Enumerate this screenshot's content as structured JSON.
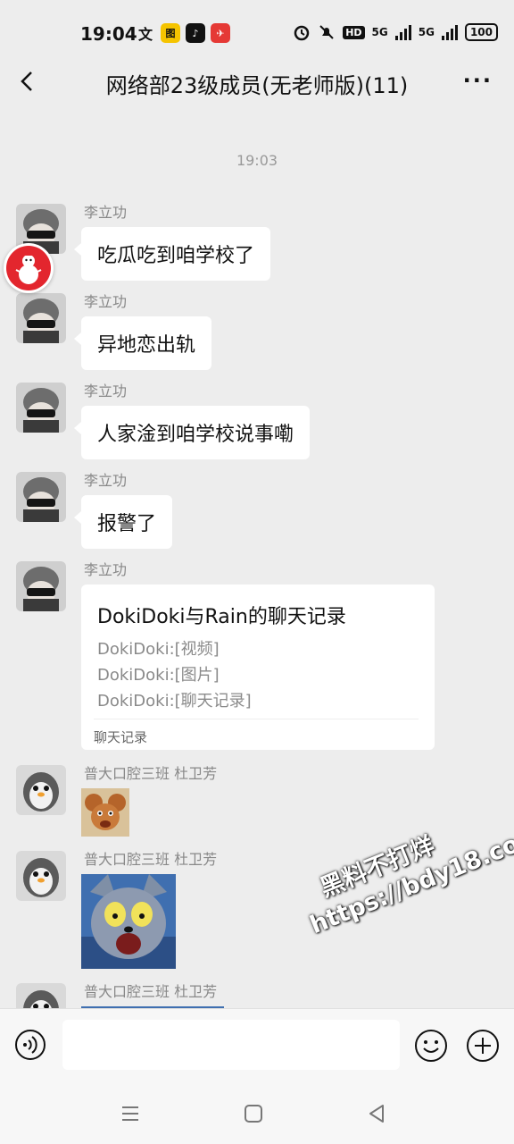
{
  "status": {
    "time": "19:04",
    "app_badges": [
      {
        "name": "translate",
        "label": "文",
        "color": "#ffffff",
        "text_color": "#111111"
      },
      {
        "name": "app-yellow",
        "label": "图",
        "color": "#f5c400",
        "text_color": "#111111"
      },
      {
        "name": "tiktok",
        "label": "♪",
        "color": "#111111",
        "text_color": "#ffffff"
      },
      {
        "name": "app-red",
        "label": "✈",
        "color": "#e53935",
        "text_color": "#ffffff"
      }
    ],
    "hd_label": "HD",
    "network_1": "5G",
    "network_2": "5G",
    "battery": "100"
  },
  "header": {
    "title": "网络部23级成员(无老师版)(11)",
    "back_icon": "chevron-left-icon",
    "more_icon": "more-dots-icon",
    "more_label": "···"
  },
  "timestamp": "19:03",
  "messages": [
    {
      "sender": "李立功",
      "text": "吃瓜吃到咱学校了"
    },
    {
      "sender": "李立功",
      "text": "异地恋出轨"
    },
    {
      "sender": "李立功",
      "text": "人家淦到咱学校说事嘞"
    },
    {
      "sender": "李立功",
      "text": "报警了"
    },
    {
      "sender": "李立功",
      "card": {
        "title": "DokiDoki与Rain的聊天记录",
        "lines": [
          "DokiDoki:[视频]",
          "DokiDoki:[图片]",
          "DokiDoki:[聊天记录]"
        ],
        "footer": "聊天记录"
      }
    },
    {
      "sender": "普大口腔三班   杜卫芳",
      "sticker": "jerry-sticker"
    },
    {
      "sender": "普大口腔三班   杜卫芳",
      "sticker": "tom-sticker"
    },
    {
      "sender": "普大口腔三班   杜卫芳",
      "sticker": "partial-sticker"
    }
  ],
  "watermark": {
    "line1": "黑料不打烊",
    "line2": "https://bdy18.co"
  },
  "input": {
    "value": "",
    "placeholder": ""
  },
  "colors": {
    "background": "#ededed",
    "bubble": "#ffffff",
    "sender_text": "#888888",
    "timestamp_text": "#999999"
  }
}
